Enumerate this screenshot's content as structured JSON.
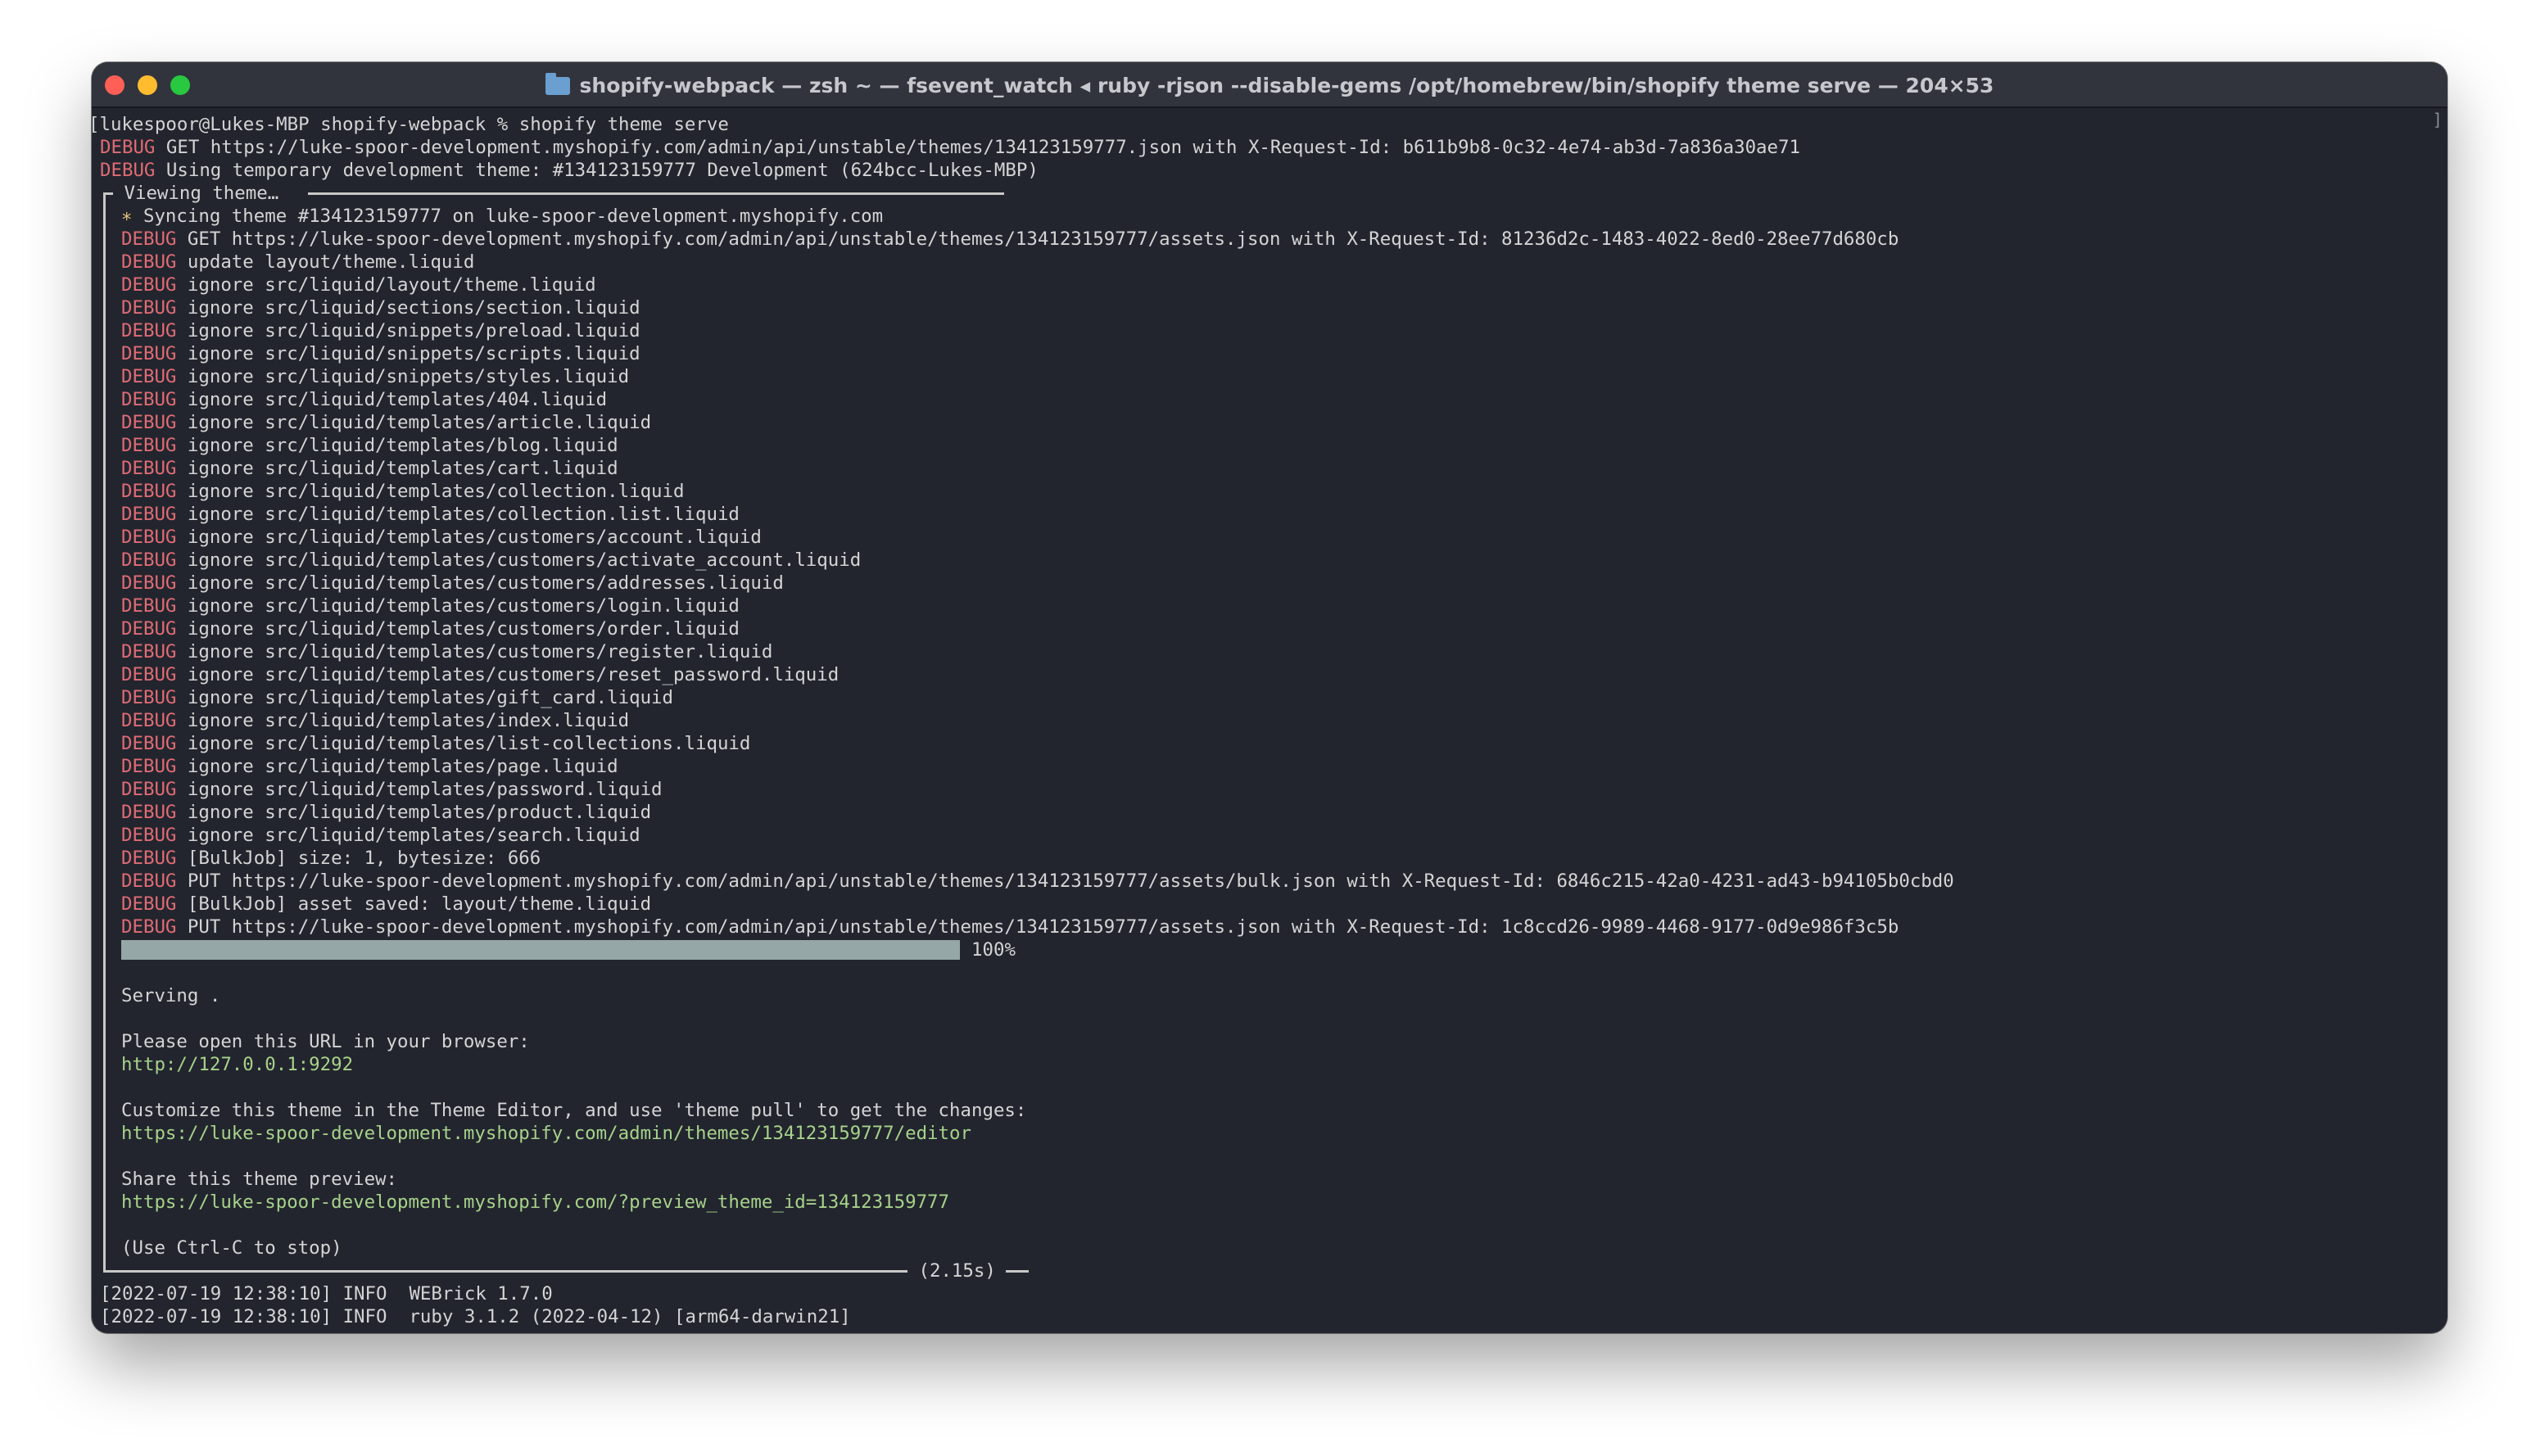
{
  "window": {
    "title": "shopify-webpack — zsh ~ — fsevent_watch ◂ ruby -rjson --disable-gems /opt/homebrew/bin/shopify theme serve — 204×53",
    "scroll_mark": "]"
  },
  "terminal": {
    "prompt_line": "[lukespoor@Lukes-MBP shopify-webpack % shopify theme serve",
    "pre_lines": [
      {
        "tag": "DEBUG",
        "text": " GET https://luke-spoor-development.myshopify.com/admin/api/unstable/themes/134123159777.json with X-Request-Id: b611b9b8-0c32-4e74-ab3d-7a836a30ae71"
      },
      {
        "tag": "DEBUG",
        "text": " Using temporary development theme: #134123159777 Development (624bcc-Lukes-MBP)"
      }
    ],
    "box_title": " Viewing theme… ",
    "sync_star": "∗",
    "sync_text": " Syncing theme #134123159777 on luke-spoor-development.myshopify.com",
    "box_lines": [
      {
        "tag": "DEBUG",
        "text": " GET https://luke-spoor-development.myshopify.com/admin/api/unstable/themes/134123159777/assets.json with X-Request-Id: 81236d2c-1483-4022-8ed0-28ee77d680cb"
      },
      {
        "tag": "DEBUG",
        "text": " update layout/theme.liquid"
      },
      {
        "tag": "DEBUG",
        "text": " ignore src/liquid/layout/theme.liquid"
      },
      {
        "tag": "DEBUG",
        "text": " ignore src/liquid/sections/section.liquid"
      },
      {
        "tag": "DEBUG",
        "text": " ignore src/liquid/snippets/preload.liquid"
      },
      {
        "tag": "DEBUG",
        "text": " ignore src/liquid/snippets/scripts.liquid"
      },
      {
        "tag": "DEBUG",
        "text": " ignore src/liquid/snippets/styles.liquid"
      },
      {
        "tag": "DEBUG",
        "text": " ignore src/liquid/templates/404.liquid"
      },
      {
        "tag": "DEBUG",
        "text": " ignore src/liquid/templates/article.liquid"
      },
      {
        "tag": "DEBUG",
        "text": " ignore src/liquid/templates/blog.liquid"
      },
      {
        "tag": "DEBUG",
        "text": " ignore src/liquid/templates/cart.liquid"
      },
      {
        "tag": "DEBUG",
        "text": " ignore src/liquid/templates/collection.liquid"
      },
      {
        "tag": "DEBUG",
        "text": " ignore src/liquid/templates/collection.list.liquid"
      },
      {
        "tag": "DEBUG",
        "text": " ignore src/liquid/templates/customers/account.liquid"
      },
      {
        "tag": "DEBUG",
        "text": " ignore src/liquid/templates/customers/activate_account.liquid"
      },
      {
        "tag": "DEBUG",
        "text": " ignore src/liquid/templates/customers/addresses.liquid"
      },
      {
        "tag": "DEBUG",
        "text": " ignore src/liquid/templates/customers/login.liquid"
      },
      {
        "tag": "DEBUG",
        "text": " ignore src/liquid/templates/customers/order.liquid"
      },
      {
        "tag": "DEBUG",
        "text": " ignore src/liquid/templates/customers/register.liquid"
      },
      {
        "tag": "DEBUG",
        "text": " ignore src/liquid/templates/customers/reset_password.liquid"
      },
      {
        "tag": "DEBUG",
        "text": " ignore src/liquid/templates/gift_card.liquid"
      },
      {
        "tag": "DEBUG",
        "text": " ignore src/liquid/templates/index.liquid"
      },
      {
        "tag": "DEBUG",
        "text": " ignore src/liquid/templates/list-collections.liquid"
      },
      {
        "tag": "DEBUG",
        "text": " ignore src/liquid/templates/page.liquid"
      },
      {
        "tag": "DEBUG",
        "text": " ignore src/liquid/templates/password.liquid"
      },
      {
        "tag": "DEBUG",
        "text": " ignore src/liquid/templates/product.liquid"
      },
      {
        "tag": "DEBUG",
        "text": " ignore src/liquid/templates/search.liquid"
      },
      {
        "tag": "DEBUG",
        "text": " [BulkJob] size: 1, bytesize: 666"
      },
      {
        "tag": "DEBUG",
        "text": " PUT https://luke-spoor-development.myshopify.com/admin/api/unstable/themes/134123159777/assets/bulk.json with X-Request-Id: 6846c215-42a0-4231-ad43-b94105b0cbd0"
      },
      {
        "tag": "DEBUG",
        "text": " [BulkJob] asset saved: layout/theme.liquid"
      },
      {
        "tag": "DEBUG",
        "text": " PUT https://luke-spoor-development.myshopify.com/admin/api/unstable/themes/134123159777/assets.json with X-Request-Id: 1c8ccd26-9989-4468-9177-0d9e986f3c5b"
      }
    ],
    "progress": {
      "fraction": 1.0,
      "label": "100%"
    },
    "serving": "Serving .",
    "open_url_label": "Please open this URL in your browser:",
    "local_url": "http://127.0.0.1:9292",
    "customize_label": "Customize this theme in the Theme Editor, and use 'theme pull' to get the changes:",
    "editor_url": "https://luke-spoor-development.myshopify.com/admin/themes/134123159777/editor",
    "share_label": "Share this theme preview:",
    "preview_url": "https://luke-spoor-development.myshopify.com/?preview_theme_id=134123159777",
    "stop_hint": "(Use Ctrl-C to stop)",
    "elapsed": " (2.15s) ",
    "post_lines": [
      "[2022-07-19 12:38:10] INFO  WEBrick 1.7.0",
      "[2022-07-19 12:38:10] INFO  ruby 3.1.2 (2022-04-12) [arm64-darwin21]"
    ]
  }
}
